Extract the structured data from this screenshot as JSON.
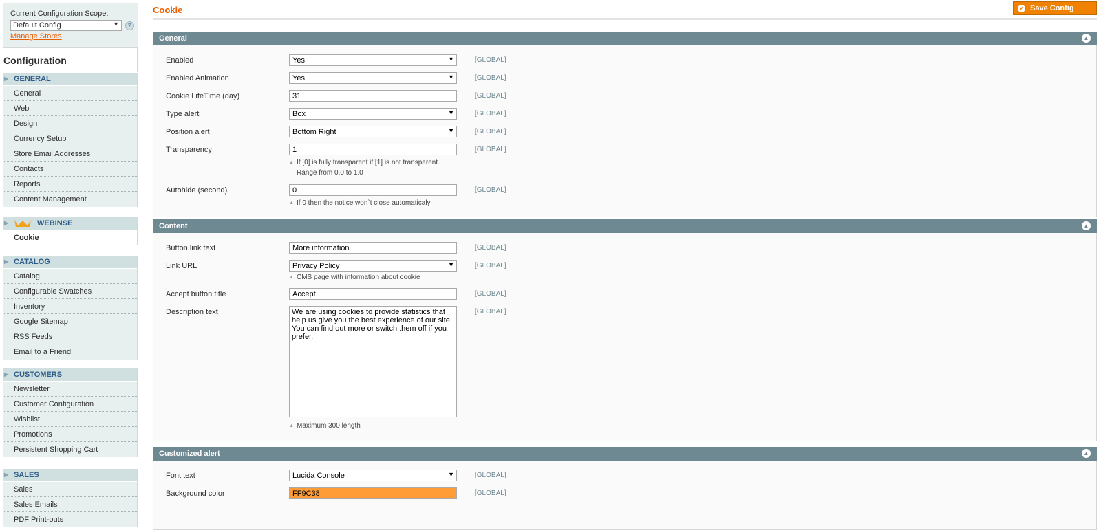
{
  "sidebar": {
    "scope_label": "Current Configuration Scope:",
    "scope_value": "Default Config",
    "manage_stores": "Manage Stores",
    "config_title": "Configuration",
    "general": {
      "header": "GENERAL",
      "items": [
        "General",
        "Web",
        "Design",
        "Currency Setup",
        "Store Email Addresses",
        "Contacts",
        "Reports",
        "Content Management"
      ]
    },
    "webinse": {
      "header": "WEBINSE",
      "items": [
        "Cookie"
      ]
    },
    "catalog": {
      "header": "CATALOG",
      "items": [
        "Catalog",
        "Configurable Swatches",
        "Inventory",
        "Google Sitemap",
        "RSS Feeds",
        "Email to a Friend"
      ]
    },
    "customers": {
      "header": "CUSTOMERS",
      "items": [
        "Newsletter",
        "Customer Configuration",
        "Wishlist",
        "Promotions",
        "Persistent Shopping Cart"
      ]
    },
    "sales": {
      "header": "SALES",
      "items": [
        "Sales",
        "Sales Emails",
        "PDF Print-outs"
      ]
    }
  },
  "main": {
    "page_title": "Cookie",
    "save_label": "Save Config",
    "scope_tag": "[GLOBAL]",
    "general": {
      "title": "General",
      "enabled": {
        "label": "Enabled",
        "value": "Yes"
      },
      "enabled_animation": {
        "label": "Enabled Animation",
        "value": "Yes"
      },
      "lifetime": {
        "label": "Cookie LifeTime (day)",
        "value": "31"
      },
      "type_alert": {
        "label": "Type alert",
        "value": "Box"
      },
      "position_alert": {
        "label": "Position alert",
        "value": "Bottom Right"
      },
      "transparency": {
        "label": "Transparency",
        "value": "1",
        "note": "If [0] is fully transparent if [1] is not transparent. Range from 0.0 to 1.0"
      },
      "autohide": {
        "label": "Autohide (second)",
        "value": "0",
        "note": "If 0 then the notice won`t close automaticaly"
      }
    },
    "content": {
      "title": "Content",
      "button_link_text": {
        "label": "Button link text",
        "value": "More information"
      },
      "link_url": {
        "label": "Link URL",
        "value": "Privacy Policy",
        "note": "CMS page with information about cookie"
      },
      "accept_title": {
        "label": "Accept button title",
        "value": "Accept"
      },
      "description": {
        "label": "Description text",
        "value": "We are using cookies to provide statistics that help us give you the best experience of our site. You can find out more or switch them off if you prefer.",
        "note": "Maximum 300 length"
      }
    },
    "customized": {
      "title": "Customized alert",
      "font_text": {
        "label": "Font text",
        "value": "Lucida Console"
      },
      "background_color": {
        "label": "Background color",
        "value": "FF9C38"
      }
    }
  },
  "colors": {
    "accent_orange": "#eb5e00",
    "button_orange": "#f18200",
    "fieldset_header": "#6f8992",
    "bg_color_swatch": "#FF9C38"
  }
}
